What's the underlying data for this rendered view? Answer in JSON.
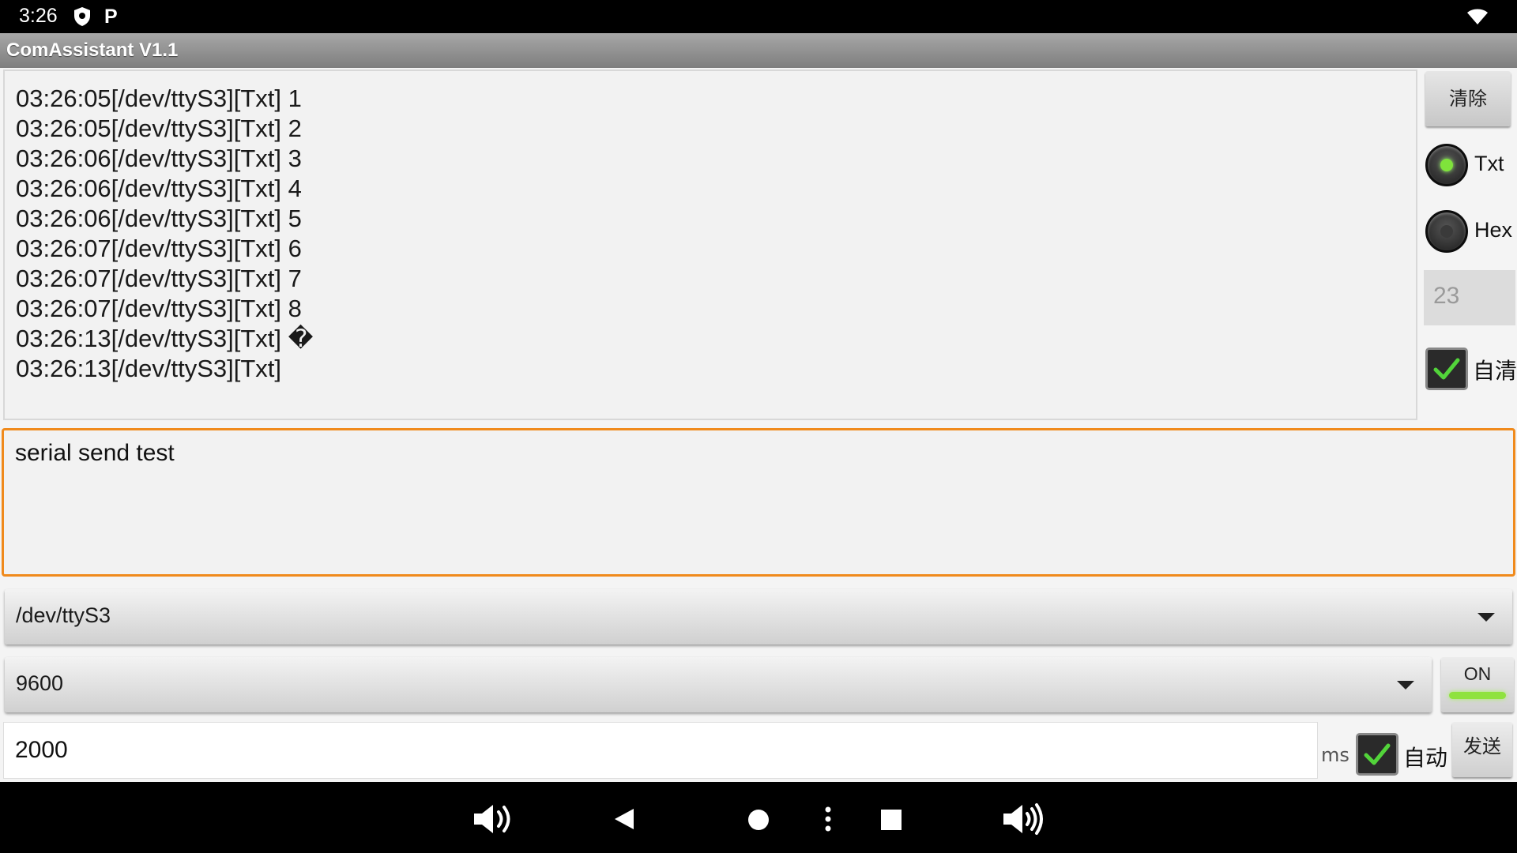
{
  "status_bar": {
    "time": "3:26",
    "icons": [
      "shield-icon",
      "p-icon",
      "wifi-icon"
    ]
  },
  "app": {
    "title": "ComAssistant V1.1"
  },
  "receive_log": {
    "lines": [
      "03:26:05[/dev/ttyS3][Txt] 1",
      "03:26:05[/dev/ttyS3][Txt] 2",
      "03:26:06[/dev/ttyS3][Txt] 3",
      "03:26:06[/dev/ttyS3][Txt] 4",
      "03:26:06[/dev/ttyS3][Txt] 5",
      "03:26:07[/dev/ttyS3][Txt] 6",
      "03:26:07[/dev/ttyS3][Txt] 7",
      "03:26:07[/dev/ttyS3][Txt] 8",
      "03:26:13[/dev/ttyS3][Txt] �",
      "03:26:13[/dev/ttyS3][Txt]"
    ]
  },
  "side_panel": {
    "clear_label": "清除",
    "radio_txt": {
      "label": "Txt",
      "selected": true
    },
    "radio_hex": {
      "label": "Hex",
      "selected": false
    },
    "line_count": "23",
    "auto_clear": {
      "label": "自清",
      "checked": true
    }
  },
  "send_text": "serial send test",
  "port_select": {
    "value": "/dev/ttyS3"
  },
  "baud_select": {
    "value": "9600"
  },
  "open_toggle": {
    "label": "ON",
    "state": "on"
  },
  "interval": {
    "value": "2000",
    "unit": "ms",
    "auto_label": "自动",
    "auto_checked": true
  },
  "send_label": "发送",
  "colors": {
    "accent_orange": "#f08a1c",
    "toggle_green": "#8fe23f",
    "check_green": "#52d43a"
  },
  "nav_bar": {
    "icons": [
      "volume-down-icon",
      "back-icon",
      "home-icon",
      "more-icon",
      "recents-icon",
      "volume-up-icon"
    ]
  }
}
